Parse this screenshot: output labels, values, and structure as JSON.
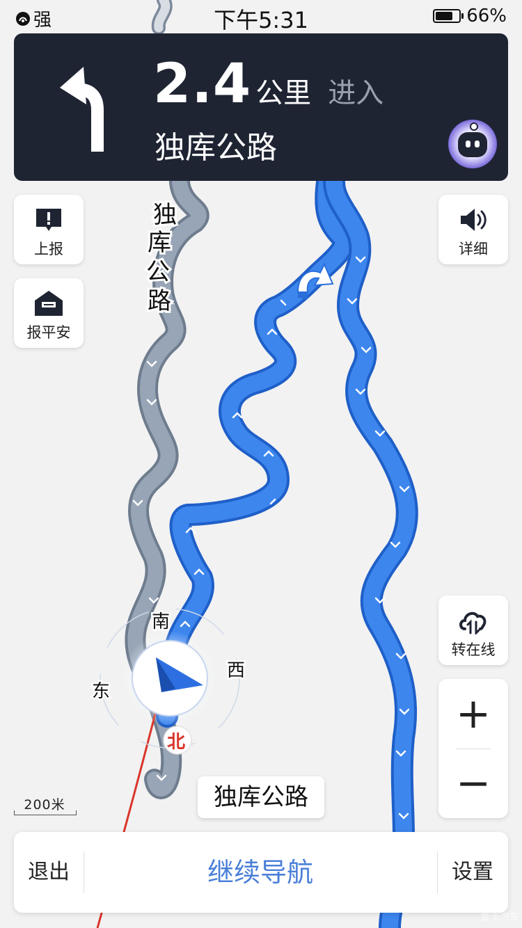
{
  "status_bar": {
    "signal_label": "强",
    "time": "下午5:31",
    "battery_percent": "66%",
    "battery_level": 0.66
  },
  "guidance": {
    "distance": "2.4",
    "unit": "公里",
    "action": "进入",
    "road": "独库公路",
    "turn_icon": "turn-left-arrow-icon"
  },
  "map": {
    "road_label_vertical": [
      "独",
      "库",
      "公",
      "路"
    ],
    "compass": {
      "north": "北",
      "south": "南",
      "east": "东",
      "west": "西"
    },
    "current_road": "独库公路",
    "scale": "200米",
    "colors": {
      "route": "#3d86ee",
      "traveled": "#8f9db0",
      "track": "#d9362b"
    }
  },
  "left_buttons": {
    "report": "上报",
    "safe": "报平安"
  },
  "right_buttons": {
    "detail": "详细",
    "online": "转在线",
    "zoom_in": "+",
    "zoom_out": "−"
  },
  "bottom_bar": {
    "exit": "退出",
    "continue": "继续导航",
    "settings": "设置"
  },
  "watermark": "爱卡汽车"
}
